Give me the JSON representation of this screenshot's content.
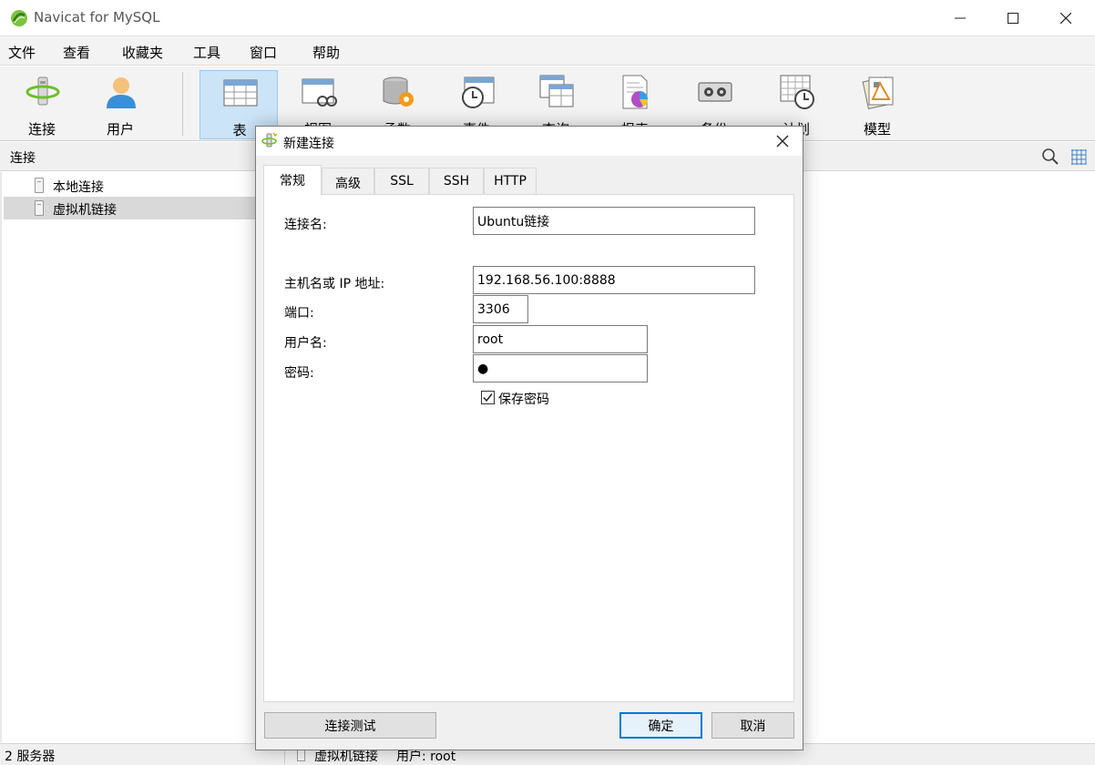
{
  "window": {
    "title": "Navicat for MySQL"
  },
  "menu": [
    "文件",
    "查看",
    "收藏夹",
    "工具",
    "窗口",
    "帮助"
  ],
  "toolbar": {
    "items": [
      {
        "label": "连接",
        "icon": "connection-icon"
      },
      {
        "label": "用户",
        "icon": "user-icon"
      },
      {
        "label": "表",
        "icon": "table-icon",
        "active": true
      },
      {
        "label": "视图",
        "icon": "view-icon"
      },
      {
        "label": "函数",
        "icon": "function-icon"
      },
      {
        "label": "事件",
        "icon": "event-icon"
      },
      {
        "label": "查询",
        "icon": "query-icon"
      },
      {
        "label": "报表",
        "icon": "report-icon"
      },
      {
        "label": "备份",
        "icon": "backup-icon"
      },
      {
        "label": "计划",
        "icon": "schedule-icon"
      },
      {
        "label": "模型",
        "icon": "model-icon"
      }
    ]
  },
  "connbar": {
    "label": "连接"
  },
  "tree": {
    "items": [
      {
        "label": "本地连接",
        "selected": false
      },
      {
        "label": "虚拟机链接",
        "selected": true
      }
    ]
  },
  "status": {
    "count": "2 服务器",
    "connection": "虚拟机链接",
    "user": "用户: root"
  },
  "dialog": {
    "title": "新建连接",
    "tabs": [
      "常规",
      "高级",
      "SSL",
      "SSH",
      "HTTP"
    ],
    "fields": {
      "conn_name": {
        "label": "连接名:",
        "value": "Ubuntu链接"
      },
      "host": {
        "label": "主机名或 IP 地址:",
        "value": "192.168.56.100:8888"
      },
      "port": {
        "label": "端口:",
        "value": "3306"
      },
      "username": {
        "label": "用户名:",
        "value": "root"
      },
      "password": {
        "label": "密码:",
        "value": "●"
      }
    },
    "save_password": {
      "label": "保存密码",
      "checked": true
    },
    "buttons": {
      "test": "连接测试",
      "ok": "确定",
      "cancel": "取消"
    }
  },
  "colors": {
    "accent": "#0078d7",
    "active_tab_bg": "#cce4f7",
    "selection": "#d9d9d9"
  }
}
